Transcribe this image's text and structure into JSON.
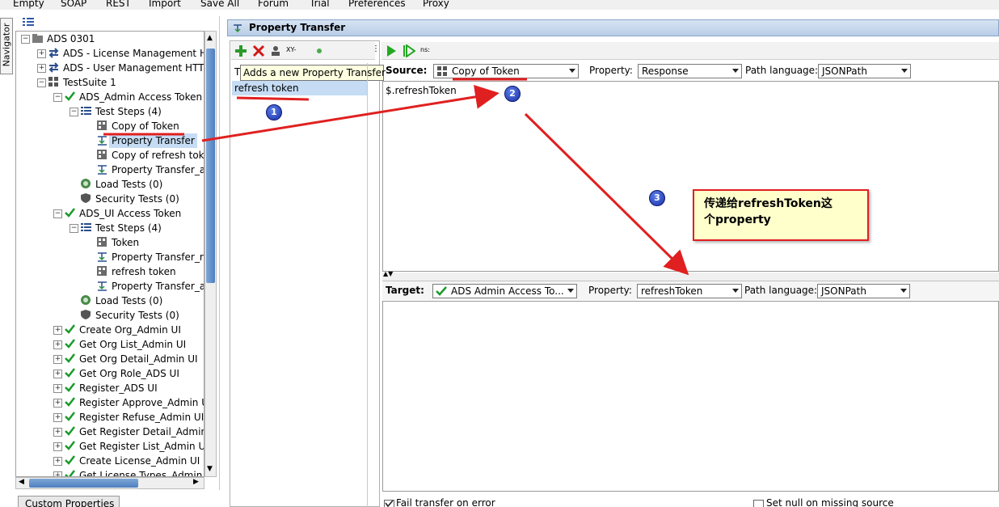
{
  "menu": [
    "Empty",
    "SOAP",
    "REST",
    "Import",
    "Save All",
    "Forum",
    "Trial",
    "Preferences",
    "Proxy"
  ],
  "navigator_tab": "Navigator",
  "tree": {
    "rows": [
      {
        "label": "ADS 0301",
        "indent": 0,
        "icon": "folder-icon",
        "exp": "-"
      },
      {
        "label": "ADS - License Management H",
        "indent": 1,
        "icon": "rest-service-icon",
        "exp": "+"
      },
      {
        "label": "ADS - User Management HTT",
        "indent": 1,
        "icon": "rest-service-icon",
        "exp": "+"
      },
      {
        "label": "TestSuite 1",
        "indent": 1,
        "icon": "testsuite-icon",
        "exp": "-"
      },
      {
        "label": "ADS_Admin Access Token",
        "indent": 2,
        "icon": "check-icon",
        "exp": "-"
      },
      {
        "label": "Test Steps (4)",
        "indent": 3,
        "icon": "teststeps-icon",
        "exp": "-"
      },
      {
        "label": "Copy of Token",
        "indent": 4,
        "icon": "request-step-icon",
        "exp": ""
      },
      {
        "label": "Property Transfer",
        "indent": 4,
        "icon": "property-transfer-icon",
        "exp": "",
        "selected": true
      },
      {
        "label": "Copy of refresh tok",
        "indent": 4,
        "icon": "request-step-icon",
        "exp": ""
      },
      {
        "label": "Property Transfer_a",
        "indent": 4,
        "icon": "property-transfer-icon",
        "exp": ""
      },
      {
        "label": "Load Tests (0)",
        "indent": 3,
        "icon": "load-test-icon",
        "exp": ""
      },
      {
        "label": "Security Tests (0)",
        "indent": 3,
        "icon": "security-test-icon",
        "exp": ""
      },
      {
        "label": "ADS_UI Access Token",
        "indent": 2,
        "icon": "check-icon",
        "exp": "-"
      },
      {
        "label": "Test Steps (4)",
        "indent": 3,
        "icon": "teststeps-icon",
        "exp": "-"
      },
      {
        "label": "Token",
        "indent": 4,
        "icon": "request-step-icon",
        "exp": ""
      },
      {
        "label": "Property Transfer_r",
        "indent": 4,
        "icon": "property-transfer-icon",
        "exp": ""
      },
      {
        "label": "refresh token",
        "indent": 4,
        "icon": "request-step-icon",
        "exp": ""
      },
      {
        "label": "Property Transfer_a",
        "indent": 4,
        "icon": "property-transfer-icon",
        "exp": ""
      },
      {
        "label": "Load Tests (0)",
        "indent": 3,
        "icon": "load-test-icon",
        "exp": ""
      },
      {
        "label": "Security Tests (0)",
        "indent": 3,
        "icon": "security-test-icon",
        "exp": ""
      },
      {
        "label": "Create Org_Admin UI",
        "indent": 2,
        "icon": "check-icon",
        "exp": "+"
      },
      {
        "label": "Get Org List_Admin UI",
        "indent": 2,
        "icon": "check-icon",
        "exp": "+"
      },
      {
        "label": "Get Org Detail_Admin UI",
        "indent": 2,
        "icon": "check-icon",
        "exp": "+"
      },
      {
        "label": "Get Org Role_ADS UI",
        "indent": 2,
        "icon": "check-icon",
        "exp": "+"
      },
      {
        "label": "Register_ADS UI",
        "indent": 2,
        "icon": "check-icon",
        "exp": "+"
      },
      {
        "label": "Register Approve_Admin U",
        "indent": 2,
        "icon": "check-icon",
        "exp": "+"
      },
      {
        "label": "Register Refuse_Admin UI",
        "indent": 2,
        "icon": "check-icon",
        "exp": "+"
      },
      {
        "label": "Get Register Detail_Admin",
        "indent": 2,
        "icon": "check-icon",
        "exp": "+"
      },
      {
        "label": "Get Register List_Admin UI",
        "indent": 2,
        "icon": "check-icon",
        "exp": "+"
      },
      {
        "label": "Create License_Admin UI",
        "indent": 2,
        "icon": "check-icon",
        "exp": "+"
      },
      {
        "label": "Get License Types_Admin UI",
        "indent": 2,
        "icon": "check-icon",
        "exp": "+"
      }
    ]
  },
  "bottom_tab": "Custom Properties",
  "editor": {
    "title": "Property Transfer",
    "list_tool_text": "XY-",
    "tooltip": "Adds a new Property Transfer",
    "list_header_char": "T",
    "transfer_item": "refresh token",
    "main_tool_text": "ns:",
    "source": {
      "label": "Source:",
      "step": "Copy of Token",
      "property_label": "Property:",
      "property": "Response",
      "path_lang_label": "Path language:",
      "path_lang": "JSONPath",
      "expression": "$.refreshToken"
    },
    "target": {
      "label": "Target:",
      "step": "ADS Admin Access To...",
      "property_label": "Property:",
      "property": "refreshToken",
      "path_lang_label": "Path language:",
      "path_lang": "JSONPath"
    },
    "footer": {
      "fail_on_error": "Fail transfer on error",
      "set_null": "Set null on missing source"
    }
  },
  "annotation": {
    "note_line1": "传递给refreshToken这",
    "note_line2": "个property",
    "badges": [
      "1",
      "2",
      "3"
    ]
  },
  "colors": {
    "annotation_red": "#e02020",
    "selection": "#c5dcf4",
    "check_green": "#1a9a2a",
    "badge_blue": "#1b2fa8"
  }
}
